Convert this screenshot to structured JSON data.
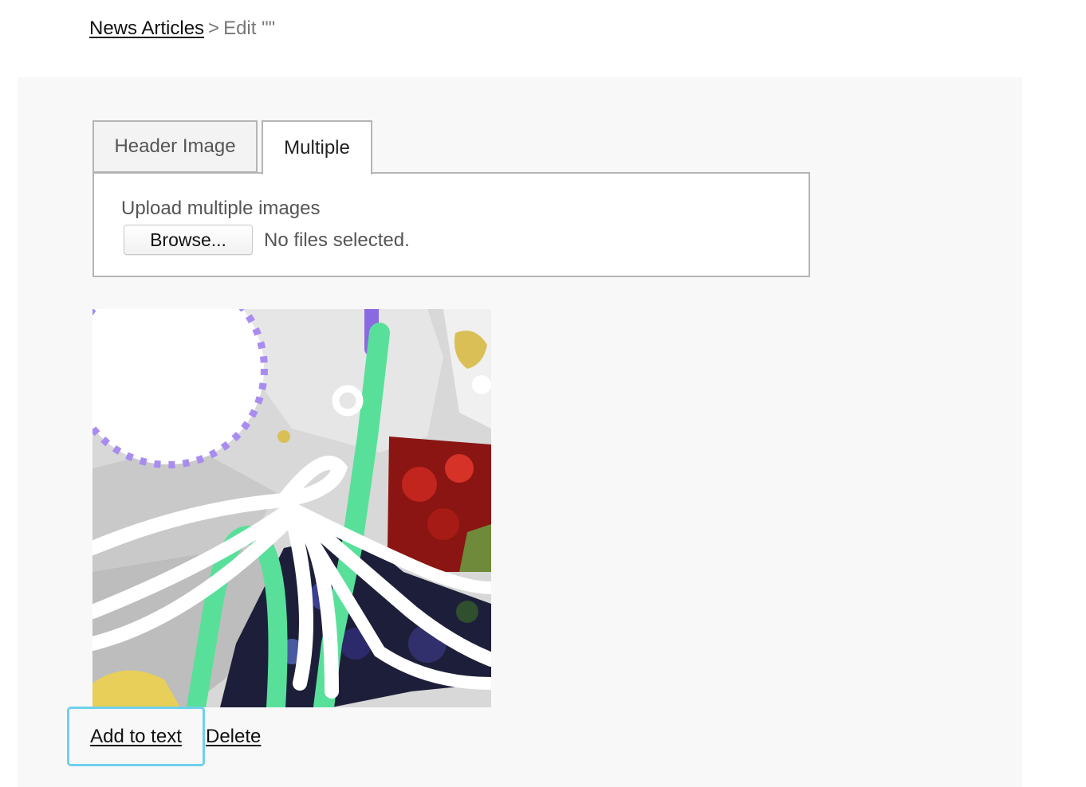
{
  "breadcrumb": {
    "parent_link": "News Articles",
    "separator": ">",
    "current": "Edit \"\""
  },
  "tabs": [
    {
      "label": "Header Image",
      "active": false
    },
    {
      "label": "Multiple",
      "active": true
    }
  ],
  "upload": {
    "label": "Upload multiple images",
    "browse_label": "Browse...",
    "status": "No files selected."
  },
  "image_actions": {
    "add_to_text": "Add to text",
    "delete": "Delete"
  },
  "colors": {
    "panel_bg": "#f8f8f8",
    "tab_border": "#b5b5b5",
    "focus_ring": "#6fd0ec",
    "link": "#111111",
    "muted_text": "#555555"
  }
}
